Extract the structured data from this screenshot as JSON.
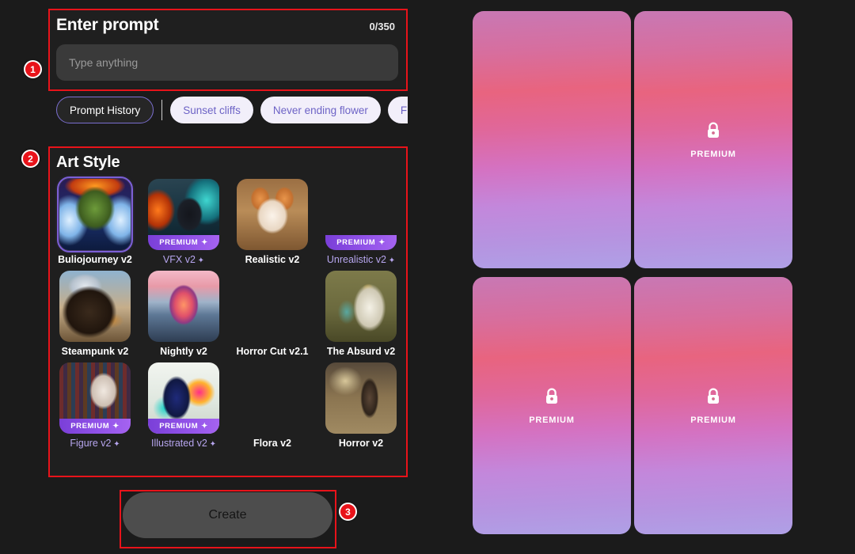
{
  "prompt": {
    "title": "Enter prompt",
    "counter": "0/350",
    "placeholder": "Type anything",
    "value": ""
  },
  "chips": {
    "history_label": "Prompt History",
    "suggestions": [
      "Sunset cliffs",
      "Never ending flower",
      "Fire and w"
    ]
  },
  "art_style": {
    "title": "Art Style",
    "items": [
      {
        "label": "Buliojourney v2",
        "premium": false,
        "selected": true,
        "sparkle": ""
      },
      {
        "label": "VFX v2",
        "premium": true,
        "selected": false,
        "sparkle": "✦"
      },
      {
        "label": "Realistic v2",
        "premium": false,
        "selected": false,
        "sparkle": ""
      },
      {
        "label": "Unrealistic v2",
        "premium": true,
        "selected": false,
        "sparkle": "✦"
      },
      {
        "label": "Steampunk v2",
        "premium": false,
        "selected": false,
        "sparkle": ""
      },
      {
        "label": "Nightly v2",
        "premium": false,
        "selected": false,
        "sparkle": ""
      },
      {
        "label": "Horror Cut v2.1",
        "premium": false,
        "selected": false,
        "sparkle": ""
      },
      {
        "label": "The Absurd v2",
        "premium": false,
        "selected": false,
        "sparkle": ""
      },
      {
        "label": "Figure v2",
        "premium": true,
        "selected": false,
        "sparkle": "✦"
      },
      {
        "label": "Illustrated v2",
        "premium": true,
        "selected": false,
        "sparkle": "✦"
      },
      {
        "label": "Flora v2",
        "premium": false,
        "selected": false,
        "sparkle": ""
      },
      {
        "label": "Horror v2",
        "premium": false,
        "selected": false,
        "sparkle": ""
      }
    ],
    "badge_label": "PREMIUM",
    "badge_sparkle": "✦"
  },
  "create": {
    "label": "Create"
  },
  "results": {
    "top_text": "",
    "cards": [
      {
        "locked": false,
        "label": ""
      },
      {
        "locked": true,
        "label": "PREMIUM"
      },
      {
        "locked": true,
        "label": "PREMIUM"
      },
      {
        "locked": true,
        "label": "PREMIUM"
      }
    ]
  },
  "annotations": {
    "markers": [
      "1",
      "2",
      "3"
    ]
  },
  "colors": {
    "accent_purple": "#7b5fd6",
    "badge_purple": "#9152e8",
    "annotation_red": "#e8131a",
    "chip_text": "#6d63c6",
    "background": "#1b1b1b"
  }
}
